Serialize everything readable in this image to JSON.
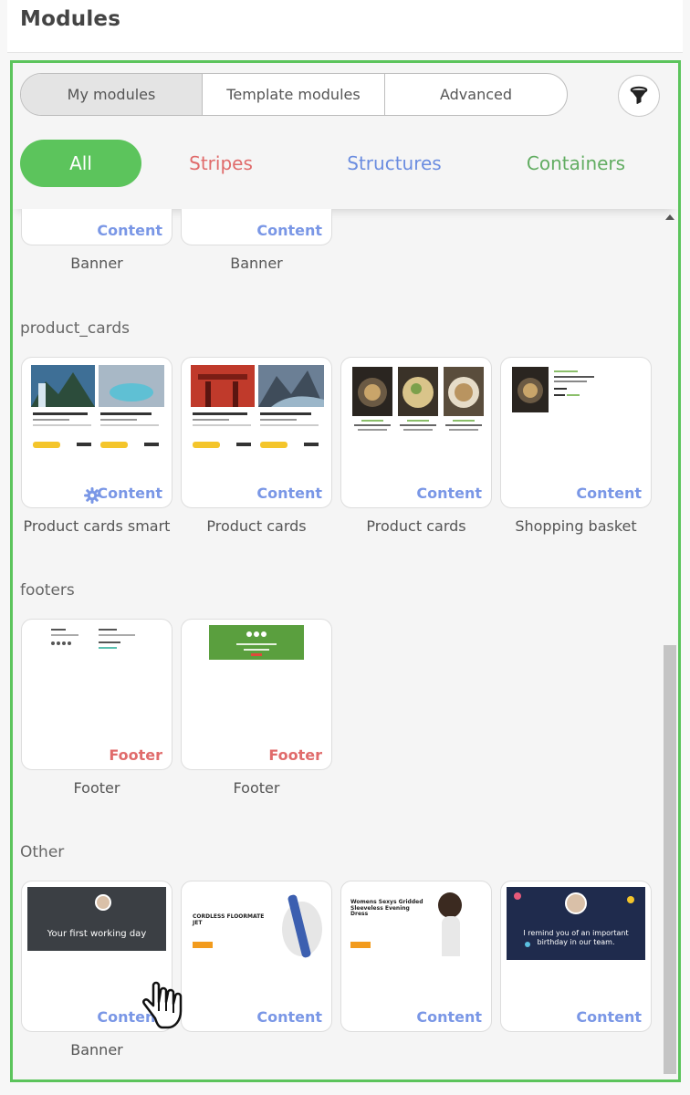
{
  "header": {
    "title": "Modules"
  },
  "tabs": [
    "My modules",
    "Template modules",
    "Advanced"
  ],
  "filter": {
    "icon": "filter-icon"
  },
  "categories": {
    "all": "All",
    "stripes": "Stripes",
    "structures": "Structures",
    "containers": "Containers"
  },
  "colors": {
    "accent": "#5cc45c",
    "stripes": "#e06b6b",
    "structures": "#6b8de0",
    "containers": "#62ad62",
    "content_badge": "#7a97e6",
    "footer_badge": "#e06b6b"
  },
  "banner_partial": {
    "cards": [
      {
        "badge": "Content",
        "caption": "Banner"
      },
      {
        "badge": "Content",
        "caption": "Banner"
      }
    ]
  },
  "product_cards": {
    "title": "product_cards",
    "cards": [
      {
        "badge": "Content",
        "caption": "Product cards smart"
      },
      {
        "badge": "Content",
        "caption": "Product cards"
      },
      {
        "badge": "Content",
        "caption": "Product cards"
      },
      {
        "badge": "Content",
        "caption": "Shopping basket"
      }
    ]
  },
  "footers": {
    "title": "footers",
    "cards": [
      {
        "badge": "Footer",
        "caption": "Footer"
      },
      {
        "badge": "Footer",
        "caption": "Footer"
      }
    ]
  },
  "other": {
    "title": "Other",
    "cards": [
      {
        "badge": "Content",
        "caption": "Banner",
        "thumb_text": "Your first working day"
      },
      {
        "badge": "Content",
        "thumb_text": "CORDLESS FLOORMATE JET"
      },
      {
        "badge": "Content",
        "thumb_text": "Womens Sexys Gridded Sleeveless Evening Dress"
      },
      {
        "badge": "Content",
        "thumb_text": "I remind you of an important birthday in our team."
      }
    ]
  }
}
